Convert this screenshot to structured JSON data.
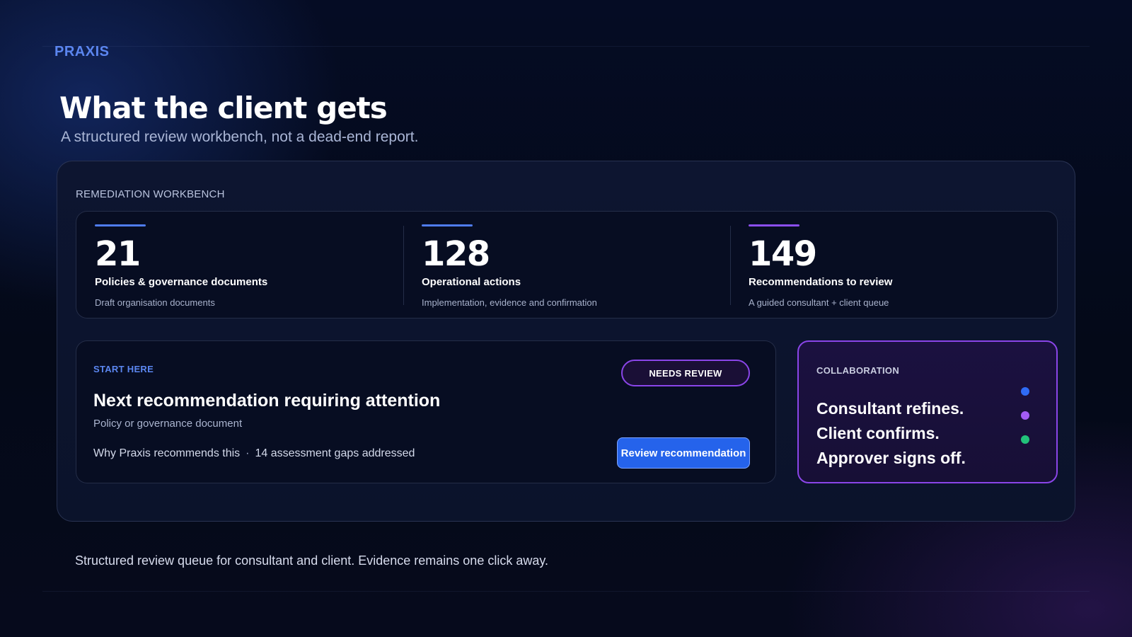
{
  "brand": "PRAXIS",
  "heading": {
    "title": "What the client gets",
    "subtitle": "A structured review workbench, not a dead-end report."
  },
  "workbench": {
    "label": "REMEDIATION WORKBENCH",
    "stats": [
      {
        "value": "21",
        "label": "Policies & governance documents",
        "desc": "Draft organisation documents",
        "accent": "#4f7cf0"
      },
      {
        "value": "128",
        "label": "Operational actions",
        "desc": "Implementation, evidence and confirmation",
        "accent": "#4f7cf0"
      },
      {
        "value": "149",
        "label": "Recommendations to review",
        "desc": "A guided consultant + client queue",
        "accent": "#8b4ff0"
      }
    ],
    "start": {
      "kicker": "START HERE",
      "badge": "NEEDS REVIEW",
      "title": "Next recommendation requiring attention",
      "subtitle": "Policy or governance document",
      "why": "Why Praxis recommends this",
      "separator": "·",
      "gaps": "14 assessment gaps addressed",
      "button": "Review recommendation"
    },
    "collaboration": {
      "kicker": "COLLABORATION",
      "lines": [
        "Consultant refines.",
        "Client confirms.",
        "Approver signs off."
      ],
      "dot_colors": [
        "#2f6bf5",
        "#a45cf5",
        "#22c27a"
      ]
    }
  },
  "footer_note": "Structured review queue for consultant and client. Evidence remains one click away."
}
